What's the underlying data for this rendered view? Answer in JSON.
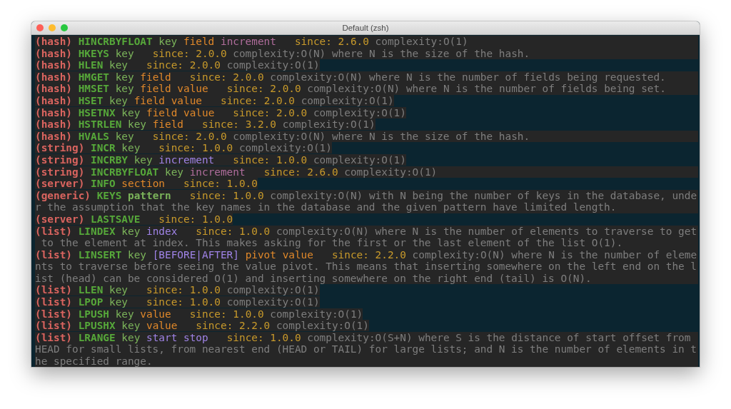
{
  "window": {
    "title": "Default (zsh)"
  },
  "entries": [
    {
      "group": "(hash)",
      "command": "HINCRBYFLOAT",
      "args": [
        {
          "text": "key",
          "color": "#7bb35a",
          "bold": false
        },
        {
          "text": "field",
          "color": "#e0882a",
          "bold": false
        },
        {
          "text": "increment",
          "color": "#b06d9c",
          "bold": false
        }
      ],
      "since": "since: 2.6.0",
      "complexity": "complexity:O(1)",
      "full_band": true
    },
    {
      "group": "(hash)",
      "command": "HKEYS",
      "args": [
        {
          "text": "key",
          "color": "#7bb35a",
          "bold": false
        }
      ],
      "since": "since: 2.0.0",
      "complexity": "complexity:O(N) where N is the size of the hash.",
      "full_band": true
    },
    {
      "group": "(hash)",
      "command": "HLEN",
      "args": [
        {
          "text": "key",
          "color": "#7bb35a",
          "bold": false
        }
      ],
      "since": "since: 2.0.0",
      "complexity": "complexity:O(1)",
      "full_band": false
    },
    {
      "group": "(hash)",
      "command": "HMGET",
      "args": [
        {
          "text": "key",
          "color": "#7bb35a",
          "bold": false
        },
        {
          "text": "field",
          "color": "#e0882a",
          "bold": false
        }
      ],
      "since": "since: 2.0.0",
      "complexity": "complexity:O(N) where N is the number of fields being requested.",
      "full_band": true
    },
    {
      "group": "(hash)",
      "command": "HMSET",
      "args": [
        {
          "text": "key",
          "color": "#7bb35a",
          "bold": false
        },
        {
          "text": "field",
          "color": "#e0882a",
          "bold": false
        },
        {
          "text": "value",
          "color": "#e0882a",
          "bold": false
        }
      ],
      "since": "since: 2.0.0",
      "complexity": "complexity:O(N) where N is the number of fields being set.",
      "full_band": true
    },
    {
      "group": "(hash)",
      "command": "HSET",
      "args": [
        {
          "text": "key",
          "color": "#7bb35a",
          "bold": false
        },
        {
          "text": "field",
          "color": "#e0882a",
          "bold": false
        },
        {
          "text": "value",
          "color": "#e0882a",
          "bold": false
        }
      ],
      "since": "since: 2.0.0",
      "complexity": "complexity:O(1)",
      "full_band": false
    },
    {
      "group": "(hash)",
      "command": "HSETNX",
      "args": [
        {
          "text": "key",
          "color": "#7bb35a",
          "bold": false
        },
        {
          "text": "field",
          "color": "#e0882a",
          "bold": false
        },
        {
          "text": "value",
          "color": "#e0882a",
          "bold": false
        }
      ],
      "since": "since: 2.0.0",
      "complexity": "complexity:O(1)",
      "full_band": false
    },
    {
      "group": "(hash)",
      "command": "HSTRLEN",
      "args": [
        {
          "text": "key",
          "color": "#7bb35a",
          "bold": false
        },
        {
          "text": "field",
          "color": "#e0882a",
          "bold": false
        }
      ],
      "since": "since: 3.2.0",
      "complexity": "complexity:O(1)",
      "full_band": false
    },
    {
      "group": "(hash)",
      "command": "HVALS",
      "args": [
        {
          "text": "key",
          "color": "#7bb35a",
          "bold": false
        }
      ],
      "since": "since: 2.0.0",
      "complexity": "complexity:O(N) where N is the size of the hash.",
      "full_band": true
    },
    {
      "group": "(string)",
      "command": "INCR",
      "args": [
        {
          "text": "key",
          "color": "#7bb35a",
          "bold": false
        }
      ],
      "since": "since: 1.0.0",
      "complexity": "complexity:O(1)",
      "full_band": false
    },
    {
      "group": "(string)",
      "command": "INCRBY",
      "args": [
        {
          "text": "key",
          "color": "#7bb35a",
          "bold": false
        },
        {
          "text": "increment",
          "color": "#9f83e6",
          "bold": false
        }
      ],
      "since": "since: 1.0.0",
      "complexity": "complexity:O(1)",
      "full_band": false
    },
    {
      "group": "(string)",
      "command": "INCRBYFLOAT",
      "args": [
        {
          "text": "key",
          "color": "#7bb35a",
          "bold": false
        },
        {
          "text": "increment",
          "color": "#b06d9c",
          "bold": false
        }
      ],
      "since": "since: 2.6.0",
      "complexity": "complexity:O(1)",
      "full_band": true
    },
    {
      "group": "(server)",
      "command": "INFO",
      "args": [
        {
          "text": "section",
          "color": "#e0882a",
          "bold": false
        }
      ],
      "since": "since: 1.0.0",
      "full_band": false
    },
    {
      "group": "(generic)",
      "command": "KEYS",
      "args": [
        {
          "text": "pattern",
          "color": "#7bb35a",
          "bold": true
        }
      ],
      "since": "since: 1.0.0",
      "complexity": "complexity:O(N) with N being the number of keys in the database, under the assumption that the key names in the database and the given pattern have limited length.",
      "full_band": true
    },
    {
      "group": "(server)",
      "command": "LASTSAVE",
      "since": "since: 1.0.0",
      "full_band": false
    },
    {
      "group": "(list)",
      "command": "LINDEX",
      "args": [
        {
          "text": "key",
          "color": "#7bb35a",
          "bold": false
        },
        {
          "text": "index",
          "color": "#9f83e6",
          "bold": false
        }
      ],
      "since": "since: 1.0.0",
      "complexity": "complexity:O(N) where N is the number of elements to traverse to get to the element at index. This makes asking for the first or the last element of the list O(1).",
      "full_band": true
    },
    {
      "group": "(list)",
      "command": "LINSERT",
      "args": [
        {
          "text": "key",
          "color": "#7bb35a",
          "bold": false
        },
        {
          "text": "[BEFORE|AFTER]",
          "color": "#9f83e6",
          "bold": false
        },
        {
          "text": "pivot",
          "color": "#e0882a",
          "bold": false
        },
        {
          "text": "value",
          "color": "#e0882a",
          "bold": false
        }
      ],
      "since": "since: 2.2.0",
      "complexity": "complexity:O(N) where N is the number of elements to traverse before seeing the value pivot. This means that inserting somewhere on the left end on the list (head) can be considered O(1) and inserting somewhere on the right end (tail) is O(N).",
      "full_band": true
    },
    {
      "group": "(list)",
      "command": "LLEN",
      "args": [
        {
          "text": "key",
          "color": "#7bb35a",
          "bold": false
        }
      ],
      "since": "since: 1.0.0",
      "complexity": "complexity:O(1)",
      "full_band": false
    },
    {
      "group": "(list)",
      "command": "LPOP",
      "args": [
        {
          "text": "key",
          "color": "#7bb35a",
          "bold": false
        }
      ],
      "since": "since: 1.0.0",
      "complexity": "complexity:O(1)",
      "full_band": false
    },
    {
      "group": "(list)",
      "command": "LPUSH",
      "args": [
        {
          "text": "key",
          "color": "#7bb35a",
          "bold": false
        },
        {
          "text": "value",
          "color": "#e0882a",
          "bold": false
        }
      ],
      "since": "since: 1.0.0",
      "complexity": "complexity:O(1)",
      "full_band": false
    },
    {
      "group": "(list)",
      "command": "LPUSHX",
      "args": [
        {
          "text": "key",
          "color": "#7bb35a",
          "bold": false
        },
        {
          "text": "value",
          "color": "#e0882a",
          "bold": false
        }
      ],
      "since": "since: 2.2.0",
      "complexity": "complexity:O(1)",
      "full_band": false
    },
    {
      "group": "(list)",
      "command": "LRANGE",
      "args": [
        {
          "text": "key",
          "color": "#7bb35a",
          "bold": false
        },
        {
          "text": "start",
          "color": "#9f83e6",
          "bold": false
        },
        {
          "text": "stop",
          "color": "#9f83e6",
          "bold": false
        }
      ],
      "since": "since: 1.0.0",
      "complexity": "complexity:O(S+N) where S is the distance of start offset from HEAD for small lists, from nearest end (HEAD or TAIL) for large lists; and N is the number of elements in the specified range.",
      "full_band": true
    }
  ]
}
